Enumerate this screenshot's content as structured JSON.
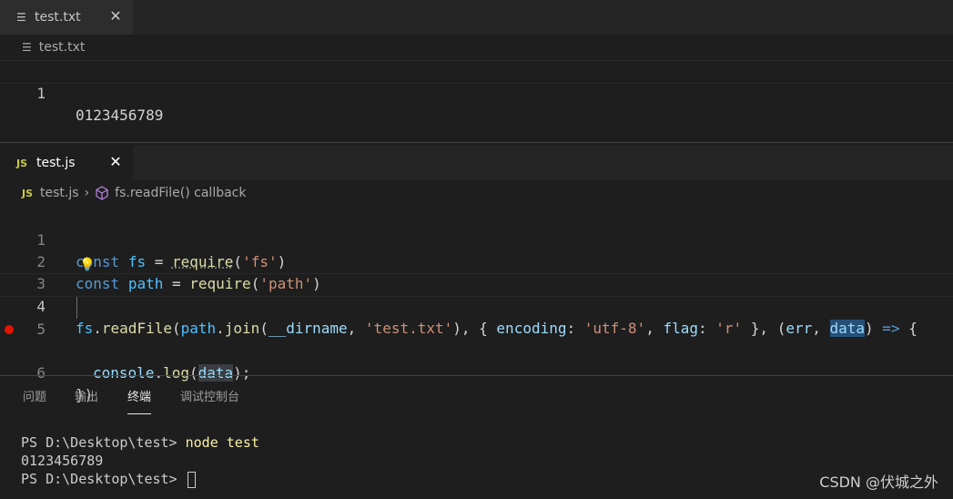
{
  "top_editor": {
    "tab": {
      "label": "test.txt",
      "close": "✕"
    },
    "breadcrumb": {
      "file": "test.txt"
    },
    "lines": [
      {
        "num": "1",
        "text": "0123456789"
      }
    ]
  },
  "bottom_editor": {
    "tab": {
      "icon": "JS",
      "label": "test.js",
      "close": "✕"
    },
    "breadcrumb": {
      "icon": "JS",
      "file": "test.js",
      "separator": "›",
      "symbol": "fs.readFile() callback"
    },
    "line_numbers": [
      "1",
      "2",
      "3",
      "4",
      "5",
      "6"
    ],
    "code": {
      "l1": {
        "kw": "const",
        "name": "fs",
        "eq": " = ",
        "fn": "require",
        "open": "(",
        "arg": "'fs'",
        "close": ")"
      },
      "l2": {
        "kw": "const",
        "name": "path",
        "eq": " = ",
        "fn": "require",
        "open": "(",
        "arg": "'path'",
        "close": ")"
      },
      "l4": {
        "obj": "fs",
        "dot": ".",
        "method": "readFile",
        "open": "(",
        "obj2": "path",
        "dot2": ".",
        "method2": "join",
        "open2": "(",
        "dirname": "__dirname",
        "comma1": ", ",
        "file": "'test.txt'",
        "close2": ")",
        "comma2": ", ",
        "brace_open": "{ ",
        "k1": "encoding",
        "colon1": ": ",
        "v1": "'utf-8'",
        "comma3": ", ",
        "k2": "flag",
        "colon2": ": ",
        "v2": "'r'",
        "brace_close": " }",
        "comma4": ", ",
        "popen": "(",
        "p1": "err",
        "comma5": ", ",
        "p2": "data",
        "pclose": ")",
        "arrow": " => ",
        "body_open": "{"
      },
      "l5": {
        "obj": "console",
        "dot": ".",
        "method": "log",
        "open": "(",
        "arg": "data",
        "close": ");"
      },
      "l6": {
        "text": "})"
      }
    }
  },
  "panel": {
    "tabs": [
      "问题",
      "输出",
      "终端",
      "调试控制台"
    ],
    "active_tab": "终端"
  },
  "terminal": {
    "line1_prompt": "PS D:\\Desktop\\test> ",
    "line1_cmd": "node test",
    "line2": "0123456789",
    "line3_prompt": "PS D:\\Desktop\\test> "
  },
  "watermark": "CSDN @伏城之外"
}
